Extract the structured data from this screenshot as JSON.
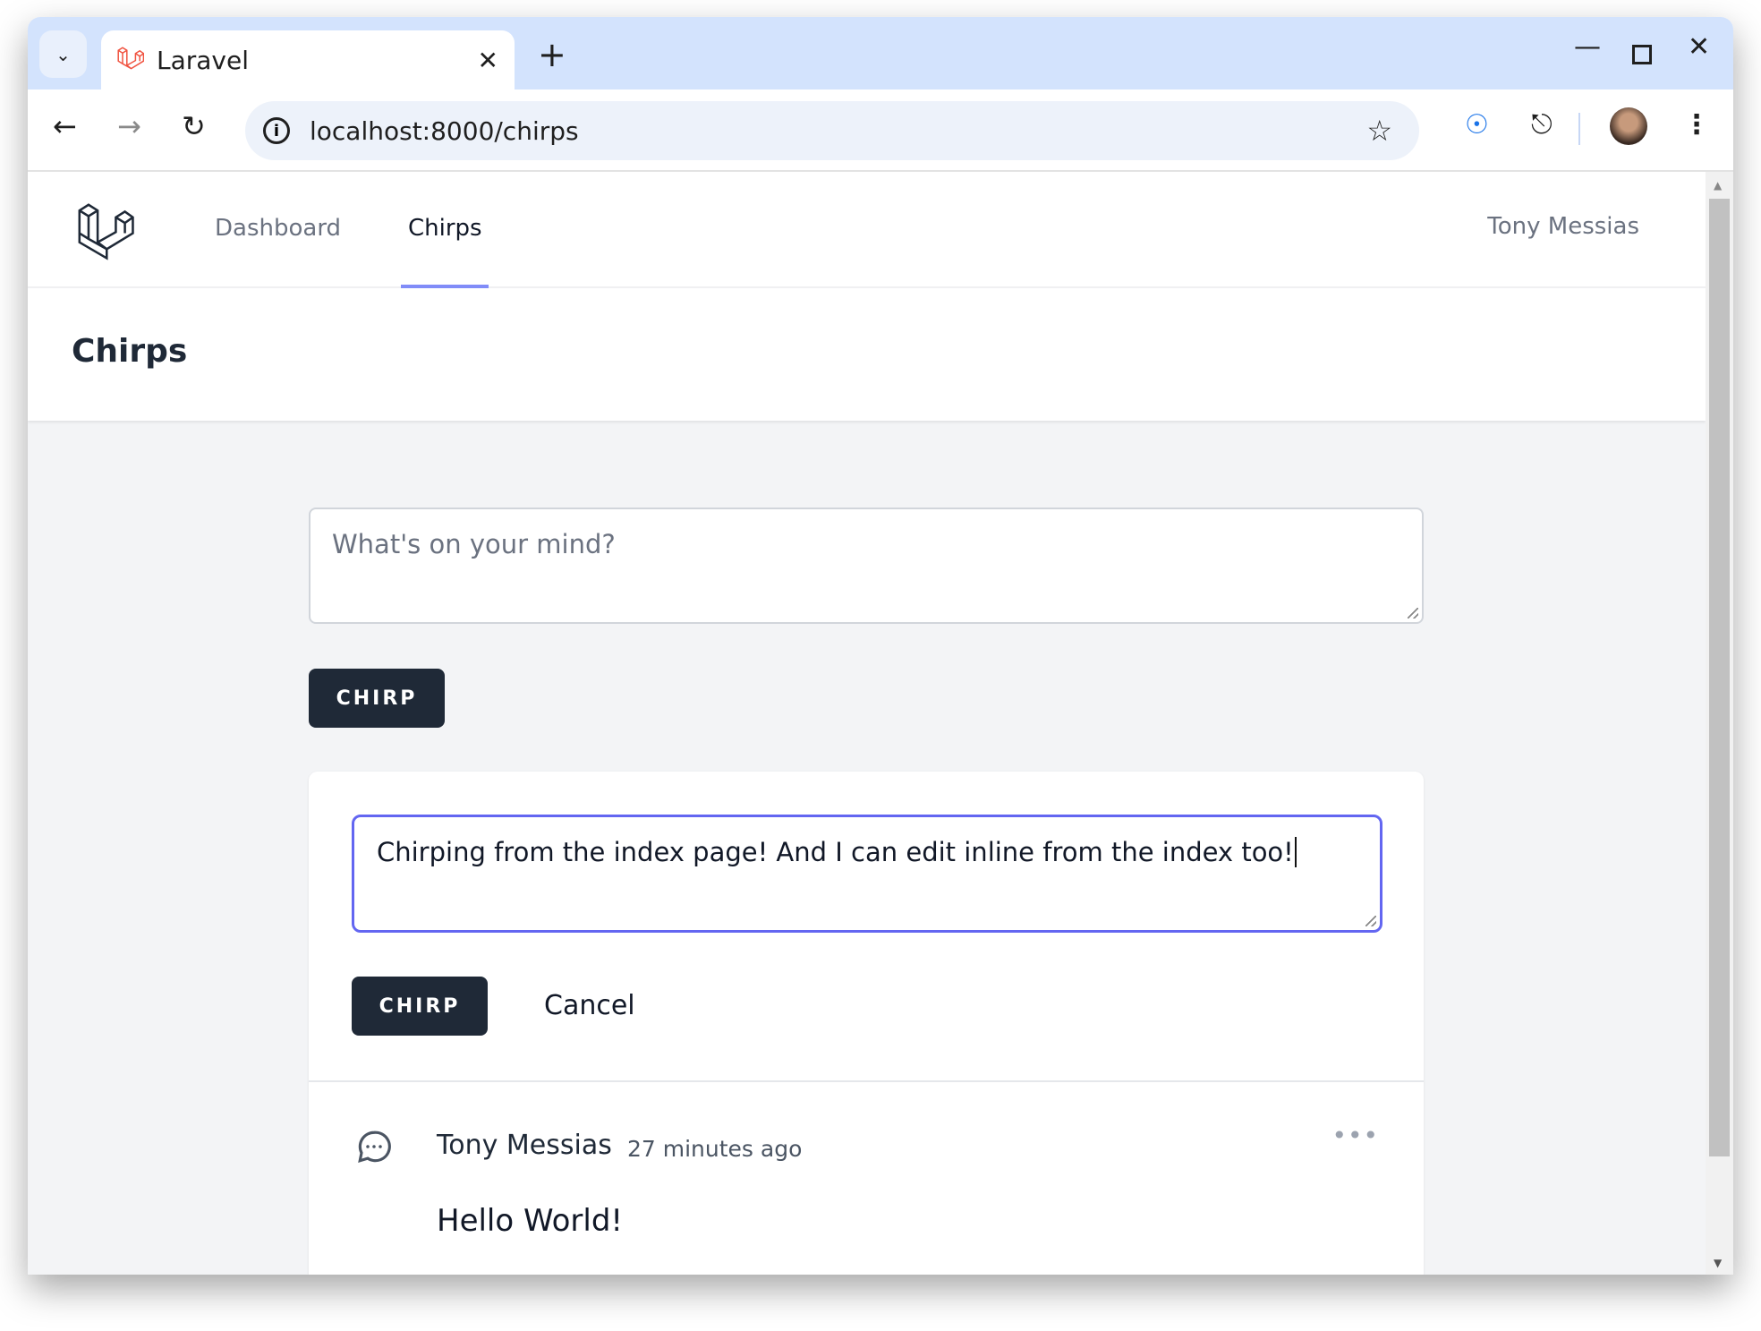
{
  "browser": {
    "tab_title": "Laravel",
    "url": "localhost:8000/chirps",
    "icons": [
      "tab-search-icon",
      "laravel-favicon",
      "close-icon",
      "plus-icon",
      "minimize-icon",
      "maximize-icon",
      "close-window-icon",
      "back-icon",
      "forward-icon",
      "reload-icon",
      "info-icon",
      "star-icon",
      "password-manager-icon",
      "extensions-icon",
      "avatar",
      "more-vert-icon"
    ]
  },
  "nav": {
    "links": [
      {
        "label": "Dashboard"
      },
      {
        "label": "Chirps",
        "active": true
      }
    ],
    "user": "Tony Messias"
  },
  "header": {
    "title": "Chirps"
  },
  "composer": {
    "placeholder": "What's on your mind?",
    "button": "CHIRP"
  },
  "edit": {
    "value": "Chirping from the index page! And I can edit inline from the index too!",
    "save": "CHIRP",
    "cancel": "Cancel"
  },
  "chirps": [
    {
      "author": "Tony Messias",
      "time": "27 minutes ago",
      "message": "Hello World!"
    }
  ],
  "colors": {
    "accent": "#6366f1",
    "button": "#1f2937",
    "tabstrip": "#d3e3fd"
  }
}
